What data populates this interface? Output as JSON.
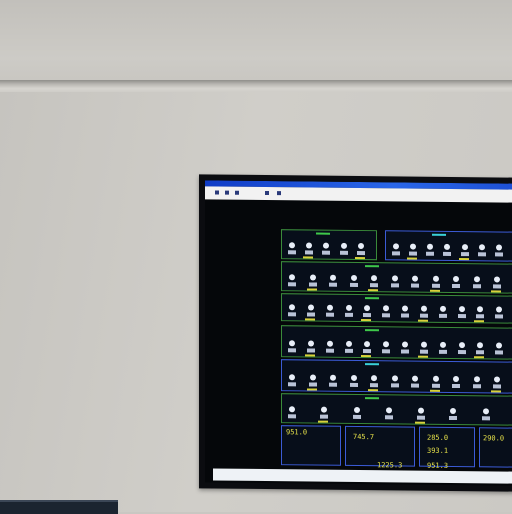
{
  "scene": {
    "description_visible": "",
    "readouts": [
      "951.0",
      "285.0",
      "393.1",
      "290.0",
      "1225.3",
      "951.3",
      "745.7"
    ]
  },
  "colors": {
    "wall": "#c9c7c2",
    "bezel": "#0b0c10",
    "titlebar": "#2a66e8",
    "readout": "#e7e24a",
    "accent_green": "#3ec84a",
    "accent_blue": "#3b5bd6"
  }
}
